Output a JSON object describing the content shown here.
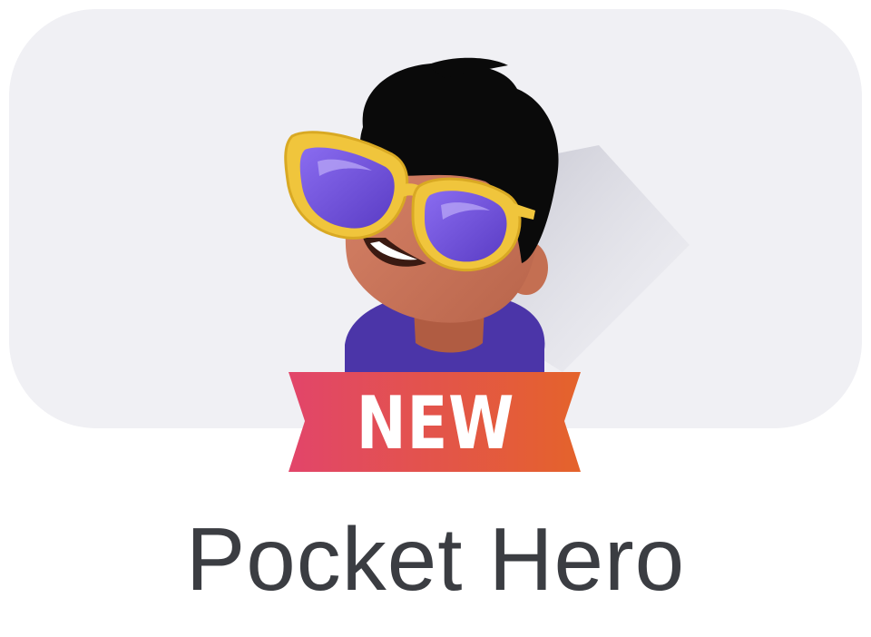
{
  "app": {
    "name": "Pocket Hero",
    "badge": "NEW",
    "icon": "pocket-hero-avatar-icon"
  },
  "colors": {
    "card_background": "#f0f0f4",
    "badge_start": "#e2456a",
    "badge_end": "#e4632b",
    "lens": "#6d4fd6",
    "frame": "#f0c53c",
    "shirt": "#4b35a8",
    "skin": "#c87356",
    "hair": "#0a0a0a",
    "label_text": "#3b3d42"
  }
}
